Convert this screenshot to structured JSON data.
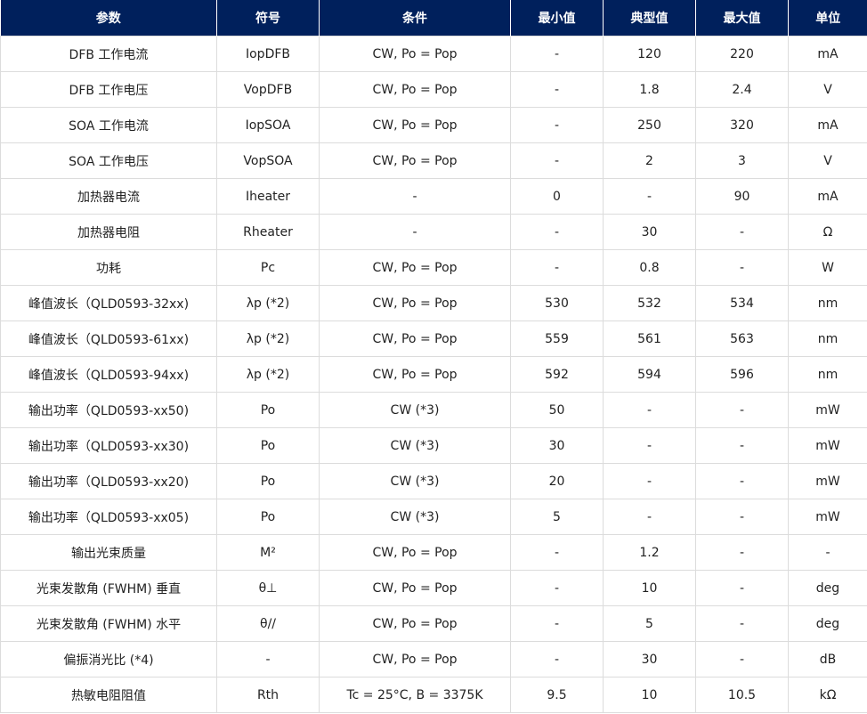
{
  "table": {
    "headers": [
      "参数",
      "符号",
      "条件",
      "最小值",
      "典型值",
      "最大值",
      "单位"
    ],
    "rows": [
      [
        "DFB 工作电流",
        "IopDFB",
        "CW, Po = Pop",
        "-",
        "120",
        "220",
        "mA"
      ],
      [
        "DFB 工作电压",
        "VopDFB",
        "CW, Po = Pop",
        "-",
        "1.8",
        "2.4",
        "V"
      ],
      [
        "SOA 工作电流",
        "IopSOA",
        "CW, Po = Pop",
        "-",
        "250",
        "320",
        "mA"
      ],
      [
        "SOA 工作电压",
        "VopSOA",
        "CW, Po = Pop",
        "-",
        "2",
        "3",
        "V"
      ],
      [
        "加热器电流",
        "Iheater",
        "-",
        "0",
        "-",
        "90",
        "mA"
      ],
      [
        "加热器电阻",
        "Rheater",
        "-",
        "-",
        "30",
        "-",
        "Ω"
      ],
      [
        "功耗",
        "Pc",
        "CW, Po = Pop",
        "-",
        "0.8",
        "-",
        "W"
      ],
      [
        "峰值波长（QLD0593-32xx)",
        "λp (*2)",
        "CW, Po = Pop",
        "530",
        "532",
        "534",
        "nm"
      ],
      [
        "峰值波长（QLD0593-61xx)",
        "λp (*2)",
        "CW, Po = Pop",
        "559",
        "561",
        "563",
        "nm"
      ],
      [
        "峰值波长（QLD0593-94xx)",
        "λp (*2)",
        "CW, Po = Pop",
        "592",
        "594",
        "596",
        "nm"
      ],
      [
        "输出功率（QLD0593-xx50)",
        "Po",
        "CW (*3)",
        "50",
        "-",
        "-",
        "mW"
      ],
      [
        "输出功率（QLD0593-xx30)",
        "Po",
        "CW (*3)",
        "30",
        "-",
        "-",
        "mW"
      ],
      [
        "输出功率（QLD0593-xx20)",
        "Po",
        "CW (*3)",
        "20",
        "-",
        "-",
        "mW"
      ],
      [
        "输出功率（QLD0593-xx05)",
        "Po",
        "CW (*3)",
        "5",
        "-",
        "-",
        "mW"
      ],
      [
        "输出光束质量",
        "M²",
        "CW, Po = Pop",
        "-",
        "1.2",
        "-",
        "-"
      ],
      [
        "光束发散角 (FWHM) 垂直",
        "θ⊥",
        "CW, Po = Pop",
        "-",
        "10",
        "-",
        "deg"
      ],
      [
        "光束发散角 (FWHM) 水平",
        "θ//",
        "CW, Po = Pop",
        "-",
        "5",
        "-",
        "deg"
      ],
      [
        "偏振消光比 (*4)",
        "-",
        "CW, Po = Pop",
        "-",
        "30",
        "-",
        "dB"
      ],
      [
        "热敏电阻阻值",
        "Rth",
        "Tc = 25°C, B = 3375K",
        "9.5",
        "10",
        "10.5",
        "kΩ"
      ]
    ]
  },
  "colors": {
    "header_bg": "#00205c",
    "header_text": "#ffffff",
    "grid": "#dcdcdc"
  }
}
